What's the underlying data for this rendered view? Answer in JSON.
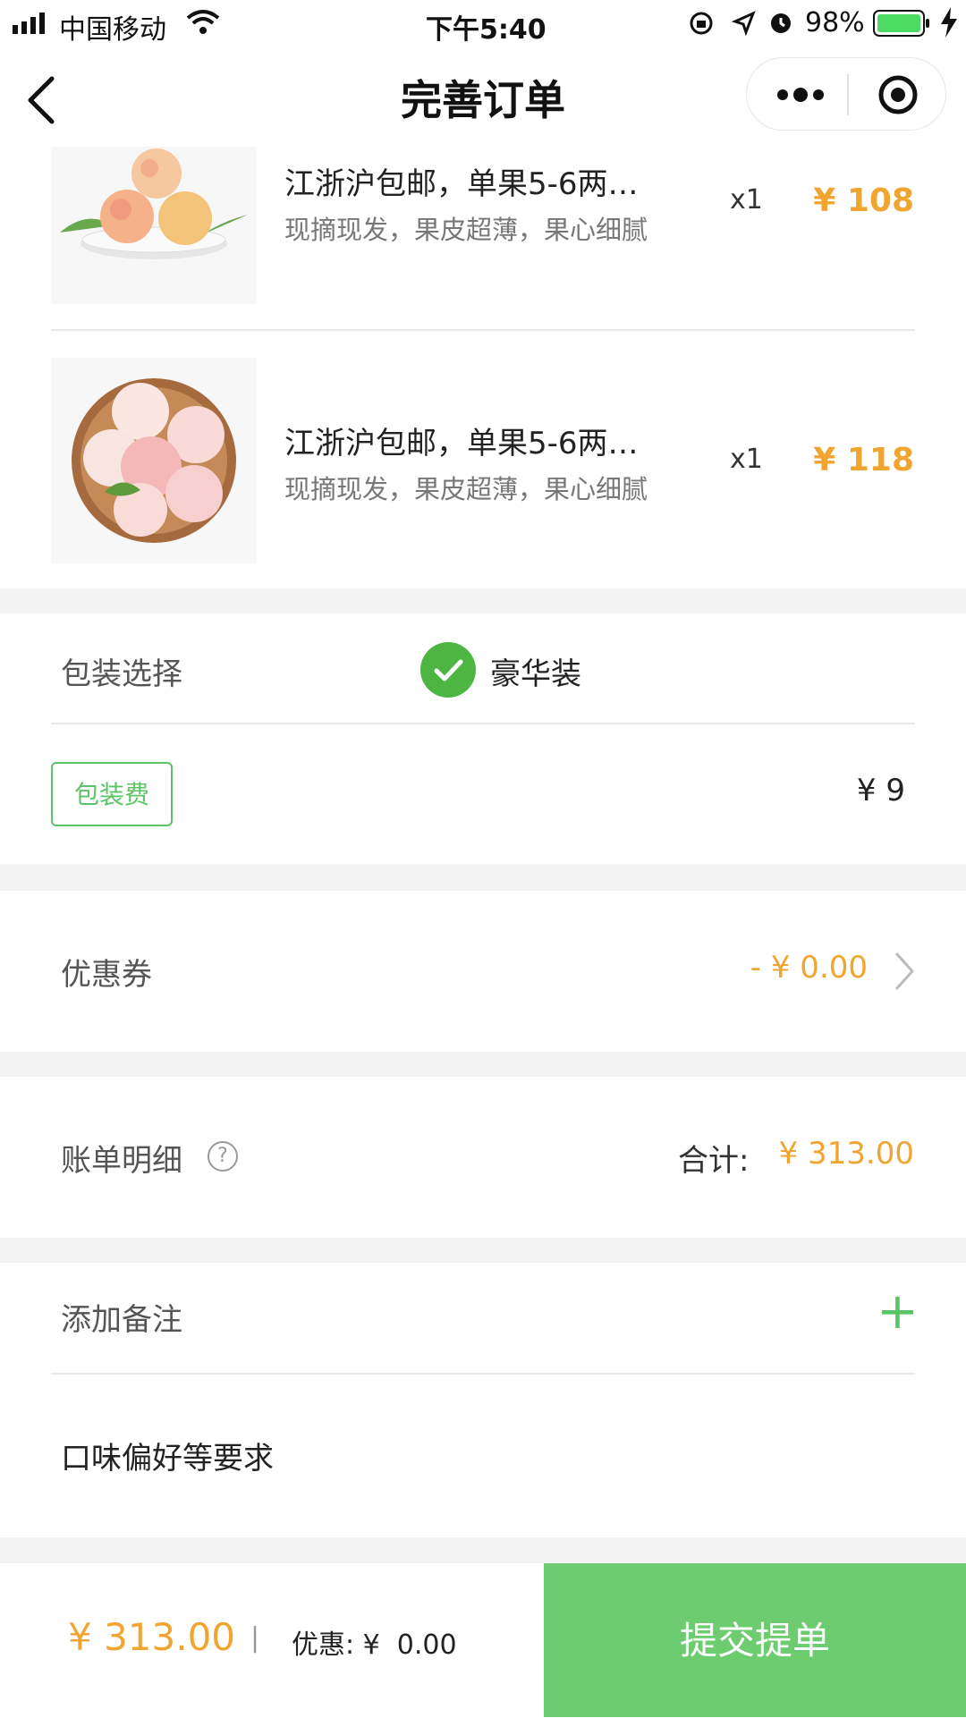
{
  "status_bar": {
    "carrier": "中国移动",
    "time": "下午5:40",
    "battery": "98%"
  },
  "nav": {
    "title": "完善订单"
  },
  "products": [
    {
      "title": "江浙沪包邮，单果5-6两…",
      "subtitle": "现摘现发，果皮超薄，果心细腻",
      "qty": "x1",
      "price": "¥ 108"
    },
    {
      "title": "江浙沪包邮，单果5-6两…",
      "subtitle": "现摘现发，果皮超薄，果心细腻",
      "qty": "x1",
      "price": "¥ 118"
    }
  ],
  "packaging": {
    "label": "包装选择",
    "option": "豪华装",
    "fee_tag": "包装费",
    "fee_value": "¥ 9"
  },
  "coupon": {
    "label": "优惠券",
    "value": "- ¥ 0.00"
  },
  "bill": {
    "label": "账单明细",
    "help": "?",
    "total_label": "合计:",
    "total_value": "¥ 313.00"
  },
  "remark": {
    "label": "添加备注",
    "add": "+",
    "placeholder": "口味偏好等要求"
  },
  "footer": {
    "total": "¥ 313.00",
    "separator": "|",
    "discount": "优惠: ¥  0.00",
    "submit": "提交提单"
  },
  "colors": {
    "accent_orange": "#f0a531",
    "accent_green": "#6ccc6f",
    "check_green": "#4db541",
    "band_gray": "#f3f3f3"
  }
}
